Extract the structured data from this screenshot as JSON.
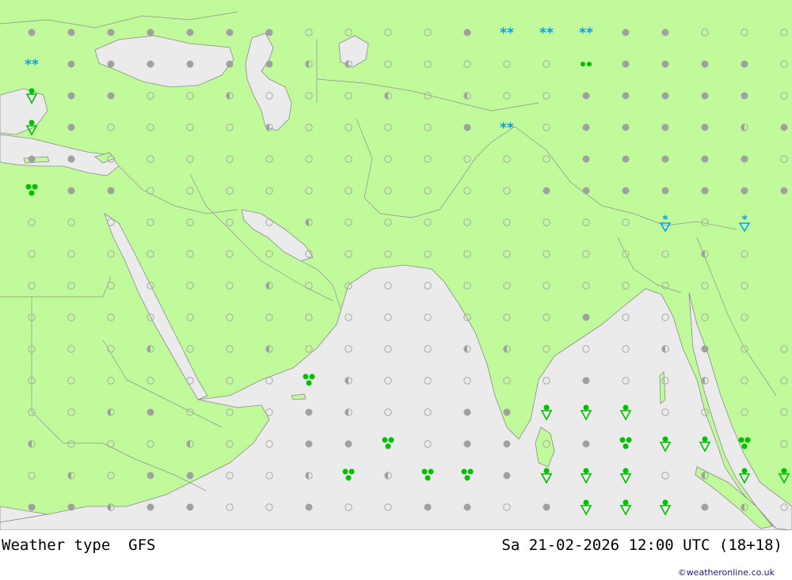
{
  "title": {
    "product": "Weather type",
    "model": "GFS",
    "valid_time": "Sa 21-02-2026 12:00 UTC (18+18)",
    "credit": "©weatheronline.co.uk"
  },
  "colors": {
    "land": "#c0fa9a",
    "sea": "#ebebeb",
    "border": "#909090",
    "dot_empty_stroke": "#a8a8a8",
    "dot_full": "#a0a0a0",
    "rain": "#00c000",
    "snow": "#00a0f0"
  },
  "legend_symbols": {
    "empty": "clear",
    "half": "partly cloudy",
    "full": "overcast",
    "shower": "rain shower",
    "drizzle": "drizzle",
    "rain": "rain",
    "snow": "snow",
    "sleet": "snow shower"
  },
  "grid": {
    "cols": 19,
    "rows": 16,
    "codes": [
      "FFFFFFFEEEEF***FFEEE",
      "*FFFFFFHHEEEEEdFFFFE*",
      "SFFEEHEEEHEHEEFFFFFE",
      "SFEEEEHEEEEF*EFFFFHF",
      "FFEEEEEEEEEEEEFFFFFE",
      "RFFEEEEEEEEEEFFFFFFF",
      "EEEEEEEHEEEEEEEEXEX",
      "EEEEEEEEEEEEEEEEEHE",
      "EEEEEEHEEEEEEEEEEEE",
      "EEEEEEEEEEEEEEFEEEE",
      "EEEHEEHEEEEHHEEEHFEE",
      "EEEEEEERHEEEEEFEEHEE",
      "EEHFEEEFHEEFFSSSEEEE",
      "HEEEHEEFFREFFEFRSSREE",
      "EHEFFEEHRHRRFSSSEHSS",
      "FFHFFEEFEEFFEFSSSFHEE"
    ]
  }
}
